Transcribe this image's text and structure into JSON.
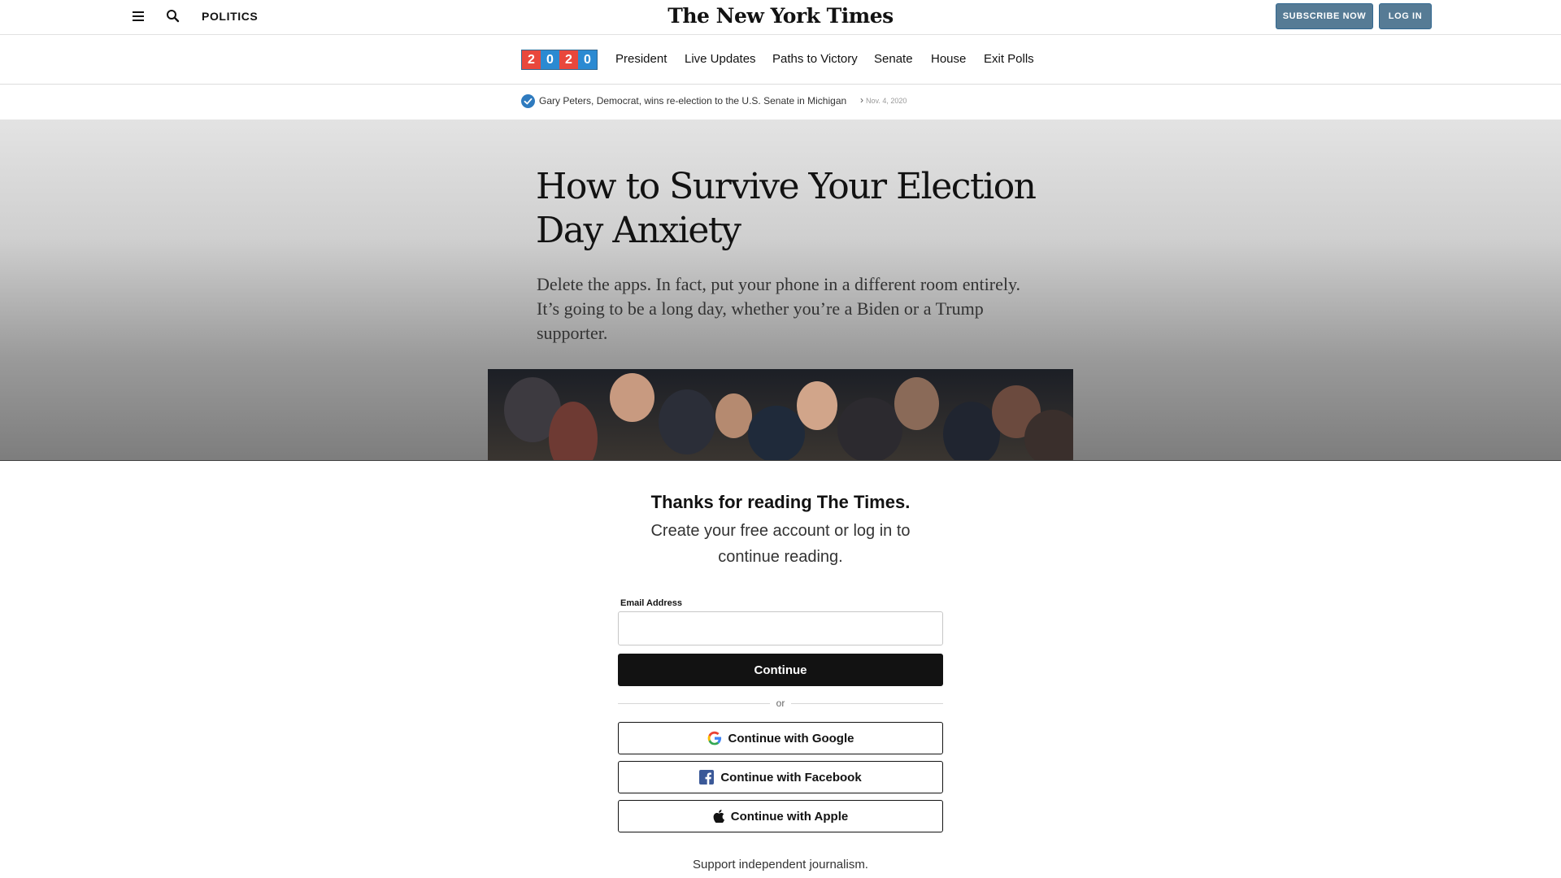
{
  "header": {
    "menu_icon": "hamburger-menu-icon",
    "search_icon": "search-icon",
    "section_label": "POLITICS",
    "logo_text": "The New York Times",
    "subscribe_label": "SUBSCRIBE NOW",
    "login_label": "LOG IN"
  },
  "election_nav": {
    "badge_digits": [
      "2",
      "0",
      "2",
      "0"
    ],
    "badge_colors": [
      "#e9473c",
      "#2b8ad2"
    ],
    "items": [
      {
        "label": "President"
      },
      {
        "label": "Live Updates"
      },
      {
        "label": "Paths to Victory"
      },
      {
        "label": "Senate"
      },
      {
        "label": "House"
      },
      {
        "label": "Exit Polls"
      }
    ]
  },
  "ticker": {
    "icon": "checkmark-icon",
    "text": "Gary Peters, Democrat, wins re-election to the U.S. Senate in Michigan",
    "arrow": "›",
    "date": "Nov. 4, 2020"
  },
  "article": {
    "headline": "How to Survive Your Election Day Anxiety",
    "dek": "Delete the apps. In fact, put your phone in a different room entirely. It’s going to be a long day, whether you’re a Biden or a Trump supporter."
  },
  "gate": {
    "title": "Thanks for reading The Times.",
    "subtitle": "Create your free account or log in to continue reading.",
    "email_label": "Email Address",
    "email_value": "",
    "continue_label": "Continue",
    "or_label": "or",
    "google_label": "Continue with Google",
    "facebook_label": "Continue with Facebook",
    "apple_label": "Continue with Apple",
    "support_text": "Support independent journalism."
  },
  "colors": {
    "subscribe_button": "#567b95",
    "checkmark": "#2f7bbf",
    "continue_button": "#121212",
    "facebook": "#3b5998"
  }
}
